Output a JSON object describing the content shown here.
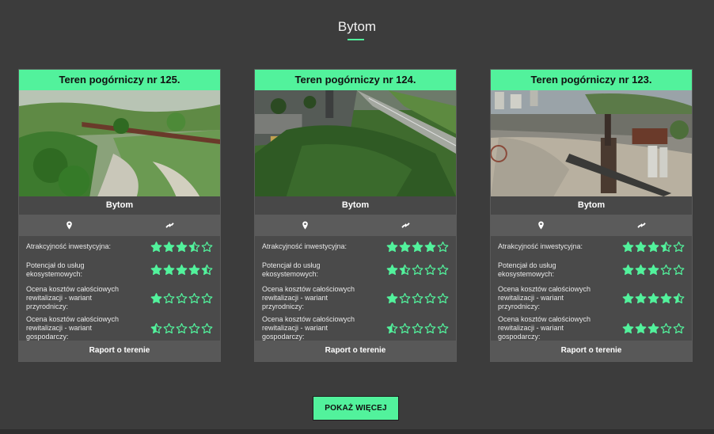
{
  "page": {
    "title": "Bytom"
  },
  "labels": {
    "rating_1": "Atrakcyjność inwestycyjna:",
    "rating_2": "Potencjał do usług ekosystemowych:",
    "rating_3": "Ocena kosztów całościowych rewitalizacji - wariant przyrodniczy:",
    "rating_4": "Ocena kosztów całościowych rewitalizacji - wariant gospodarczy:"
  },
  "icons": {
    "location": "map-pin-icon",
    "area": "satellite-icon"
  },
  "colors": {
    "accent": "#52f29c",
    "background": "#3c3c3c"
  },
  "cards": [
    {
      "title": "Teren pogórniczy nr 125.",
      "city": "Bytom",
      "report_label": "Raport o terenie",
      "ratings": [
        3.5,
        4.5,
        1,
        0.5
      ]
    },
    {
      "title": "Teren pogórniczy nr 124.",
      "city": "Bytom",
      "report_label": "Raport o terenie",
      "ratings": [
        4,
        1.5,
        1,
        0.5
      ]
    },
    {
      "title": "Teren pogórniczy nr 123.",
      "city": "Bytom",
      "report_label": "Raport o terenie",
      "ratings": [
        3.5,
        3,
        4.5,
        3
      ]
    }
  ],
  "more_button": {
    "label": "POKAŻ WIĘCEJ"
  }
}
